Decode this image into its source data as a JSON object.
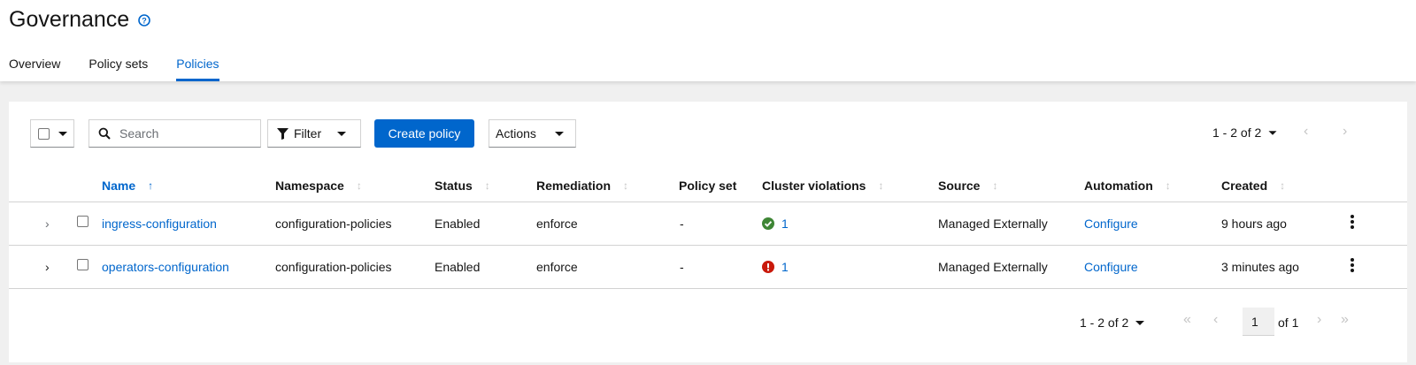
{
  "header": {
    "title": "Governance",
    "tabs": [
      {
        "label": "Overview",
        "active": false
      },
      {
        "label": "Policy sets",
        "active": false
      },
      {
        "label": "Policies",
        "active": true
      }
    ]
  },
  "toolbar": {
    "search_placeholder": "Search",
    "filter_label": "Filter",
    "create_label": "Create policy",
    "actions_label": "Actions",
    "pagination_top": "1 - 2 of 2"
  },
  "table": {
    "columns": [
      "Name",
      "Namespace",
      "Status",
      "Remediation",
      "Policy set",
      "Cluster violations",
      "Source",
      "Automation",
      "Created"
    ],
    "sort_column": "Name",
    "rows": [
      {
        "name": "ingress-configuration",
        "namespace": "configuration-policies",
        "status": "Enabled",
        "remediation": "enforce",
        "policy_set": "-",
        "violations": "1",
        "violation_state": "compliant",
        "source": "Managed Externally",
        "automation": "Configure",
        "created": "9 hours ago"
      },
      {
        "name": "operators-configuration",
        "namespace": "configuration-policies",
        "status": "Enabled",
        "remediation": "enforce",
        "policy_set": "-",
        "violations": "1",
        "violation_state": "violation",
        "source": "Managed Externally",
        "automation": "Configure",
        "created": "3 minutes ago"
      }
    ]
  },
  "pagination_bottom": {
    "range": "1 - 2 of 2",
    "page": "1",
    "of_pages": "of 1"
  },
  "colors": {
    "accent": "#0066cc",
    "success": "#3e8635",
    "danger": "#c9190b"
  }
}
